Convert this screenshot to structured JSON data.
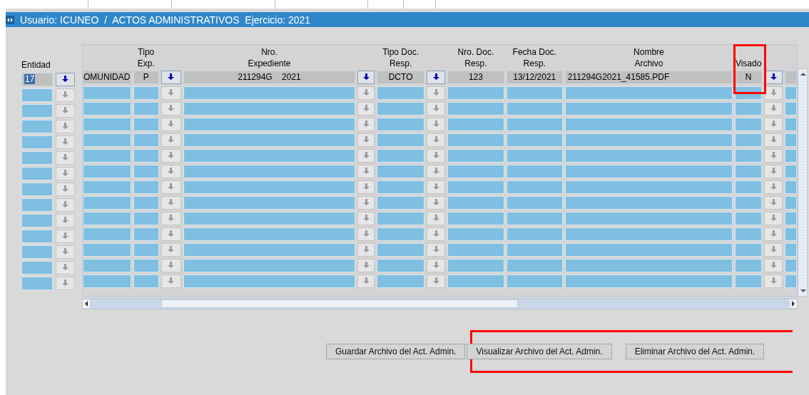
{
  "window": {
    "title": "Usuario: ICUNEO  /  ACTOS ADMINISTRATIVOS  Ejercicio: 2021"
  },
  "entidad_label": "Entidad",
  "columns": [
    {
      "kind": "text"
    },
    {
      "kind": "text",
      "header": [
        "Tipo",
        "Exp."
      ]
    },
    {
      "kind": "lov"
    },
    {
      "kind": "text",
      "header": [
        "Nro.",
        "Expediente"
      ]
    },
    {
      "kind": "lov"
    },
    {
      "kind": "text",
      "header": [
        "Tipo Doc.",
        "Resp."
      ]
    },
    {
      "kind": "lov"
    },
    {
      "kind": "text",
      "header": [
        "Nro. Doc.",
        "Resp."
      ]
    },
    {
      "kind": "text",
      "header": [
        "Fecha Doc.",
        "Resp."
      ]
    },
    {
      "kind": "text",
      "header": [
        "Nombre",
        "Archivo"
      ]
    },
    {
      "kind": "text",
      "header": [
        "Visado"
      ],
      "highlighted": true
    },
    {
      "kind": "lov"
    },
    {
      "kind": "text"
    }
  ],
  "rows": [
    {
      "active": true,
      "entidad": "17",
      "entidad_selected": true,
      "cells": [
        "OMUNIDAD",
        "P",
        "211294G    2021",
        "DCTO",
        "123",
        "13/12/2021",
        "211294G2021_41585.PDF",
        "N"
      ]
    },
    {
      "active": false
    },
    {
      "active": false
    },
    {
      "active": false
    },
    {
      "active": false
    },
    {
      "active": false
    },
    {
      "active": false
    },
    {
      "active": false
    },
    {
      "active": false
    },
    {
      "active": false
    },
    {
      "active": false
    },
    {
      "active": false
    },
    {
      "active": false
    },
    {
      "active": false
    }
  ],
  "buttons": [
    {
      "label": "Guardar Archivo del Act. Admin.",
      "highlighted": false
    },
    {
      "label": "Visualizar Archivo del Act. Admin.",
      "highlighted": true
    },
    {
      "label": "Eliminar Archivo del Act. Admin.",
      "highlighted": true
    }
  ]
}
